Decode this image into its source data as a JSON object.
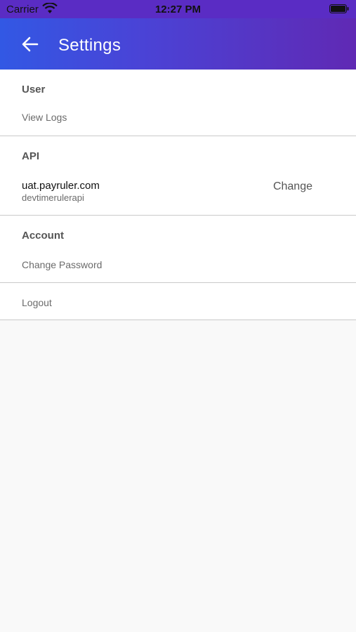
{
  "status_bar": {
    "carrier": "Carrier",
    "time": "12:27 PM",
    "wifi_icon": "wifi-icon",
    "battery_icon": "battery-icon"
  },
  "app_bar": {
    "title": "Settings",
    "back_icon": "arrow-left-icon",
    "gradient_colors": [
      "#3258e4",
      "#6029b4"
    ]
  },
  "sections": {
    "user": {
      "header": "User",
      "items": [
        {
          "label": "View Logs"
        }
      ]
    },
    "api": {
      "header": "API",
      "host": "uat.payruler.com",
      "name": "devtimerulerapi",
      "change_label": "Change"
    },
    "account": {
      "header": "Account",
      "items": [
        {
          "label": "Change Password"
        }
      ]
    },
    "logout": {
      "label": "Logout"
    }
  }
}
